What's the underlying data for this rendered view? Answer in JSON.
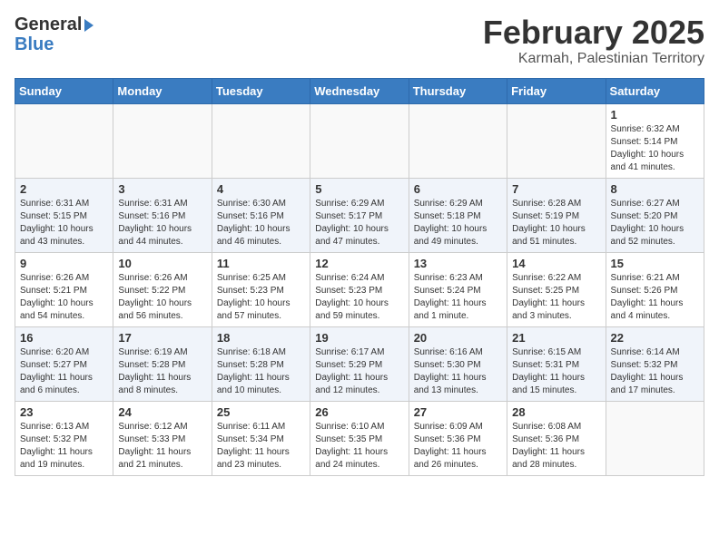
{
  "header": {
    "logo_general": "General",
    "logo_blue": "Blue",
    "month": "February 2025",
    "location": "Karmah, Palestinian Territory"
  },
  "weekdays": [
    "Sunday",
    "Monday",
    "Tuesday",
    "Wednesday",
    "Thursday",
    "Friday",
    "Saturday"
  ],
  "weeks": [
    [
      {
        "day": "",
        "info": ""
      },
      {
        "day": "",
        "info": ""
      },
      {
        "day": "",
        "info": ""
      },
      {
        "day": "",
        "info": ""
      },
      {
        "day": "",
        "info": ""
      },
      {
        "day": "",
        "info": ""
      },
      {
        "day": "1",
        "info": "Sunrise: 6:32 AM\nSunset: 5:14 PM\nDaylight: 10 hours\nand 41 minutes."
      }
    ],
    [
      {
        "day": "2",
        "info": "Sunrise: 6:31 AM\nSunset: 5:15 PM\nDaylight: 10 hours\nand 43 minutes."
      },
      {
        "day": "3",
        "info": "Sunrise: 6:31 AM\nSunset: 5:16 PM\nDaylight: 10 hours\nand 44 minutes."
      },
      {
        "day": "4",
        "info": "Sunrise: 6:30 AM\nSunset: 5:16 PM\nDaylight: 10 hours\nand 46 minutes."
      },
      {
        "day": "5",
        "info": "Sunrise: 6:29 AM\nSunset: 5:17 PM\nDaylight: 10 hours\nand 47 minutes."
      },
      {
        "day": "6",
        "info": "Sunrise: 6:29 AM\nSunset: 5:18 PM\nDaylight: 10 hours\nand 49 minutes."
      },
      {
        "day": "7",
        "info": "Sunrise: 6:28 AM\nSunset: 5:19 PM\nDaylight: 10 hours\nand 51 minutes."
      },
      {
        "day": "8",
        "info": "Sunrise: 6:27 AM\nSunset: 5:20 PM\nDaylight: 10 hours\nand 52 minutes."
      }
    ],
    [
      {
        "day": "9",
        "info": "Sunrise: 6:26 AM\nSunset: 5:21 PM\nDaylight: 10 hours\nand 54 minutes."
      },
      {
        "day": "10",
        "info": "Sunrise: 6:26 AM\nSunset: 5:22 PM\nDaylight: 10 hours\nand 56 minutes."
      },
      {
        "day": "11",
        "info": "Sunrise: 6:25 AM\nSunset: 5:23 PM\nDaylight: 10 hours\nand 57 minutes."
      },
      {
        "day": "12",
        "info": "Sunrise: 6:24 AM\nSunset: 5:23 PM\nDaylight: 10 hours\nand 59 minutes."
      },
      {
        "day": "13",
        "info": "Sunrise: 6:23 AM\nSunset: 5:24 PM\nDaylight: 11 hours\nand 1 minute."
      },
      {
        "day": "14",
        "info": "Sunrise: 6:22 AM\nSunset: 5:25 PM\nDaylight: 11 hours\nand 3 minutes."
      },
      {
        "day": "15",
        "info": "Sunrise: 6:21 AM\nSunset: 5:26 PM\nDaylight: 11 hours\nand 4 minutes."
      }
    ],
    [
      {
        "day": "16",
        "info": "Sunrise: 6:20 AM\nSunset: 5:27 PM\nDaylight: 11 hours\nand 6 minutes."
      },
      {
        "day": "17",
        "info": "Sunrise: 6:19 AM\nSunset: 5:28 PM\nDaylight: 11 hours\nand 8 minutes."
      },
      {
        "day": "18",
        "info": "Sunrise: 6:18 AM\nSunset: 5:28 PM\nDaylight: 11 hours\nand 10 minutes."
      },
      {
        "day": "19",
        "info": "Sunrise: 6:17 AM\nSunset: 5:29 PM\nDaylight: 11 hours\nand 12 minutes."
      },
      {
        "day": "20",
        "info": "Sunrise: 6:16 AM\nSunset: 5:30 PM\nDaylight: 11 hours\nand 13 minutes."
      },
      {
        "day": "21",
        "info": "Sunrise: 6:15 AM\nSunset: 5:31 PM\nDaylight: 11 hours\nand 15 minutes."
      },
      {
        "day": "22",
        "info": "Sunrise: 6:14 AM\nSunset: 5:32 PM\nDaylight: 11 hours\nand 17 minutes."
      }
    ],
    [
      {
        "day": "23",
        "info": "Sunrise: 6:13 AM\nSunset: 5:32 PM\nDaylight: 11 hours\nand 19 minutes."
      },
      {
        "day": "24",
        "info": "Sunrise: 6:12 AM\nSunset: 5:33 PM\nDaylight: 11 hours\nand 21 minutes."
      },
      {
        "day": "25",
        "info": "Sunrise: 6:11 AM\nSunset: 5:34 PM\nDaylight: 11 hours\nand 23 minutes."
      },
      {
        "day": "26",
        "info": "Sunrise: 6:10 AM\nSunset: 5:35 PM\nDaylight: 11 hours\nand 24 minutes."
      },
      {
        "day": "27",
        "info": "Sunrise: 6:09 AM\nSunset: 5:36 PM\nDaylight: 11 hours\nand 26 minutes."
      },
      {
        "day": "28",
        "info": "Sunrise: 6:08 AM\nSunset: 5:36 PM\nDaylight: 11 hours\nand 28 minutes."
      },
      {
        "day": "",
        "info": ""
      }
    ]
  ]
}
